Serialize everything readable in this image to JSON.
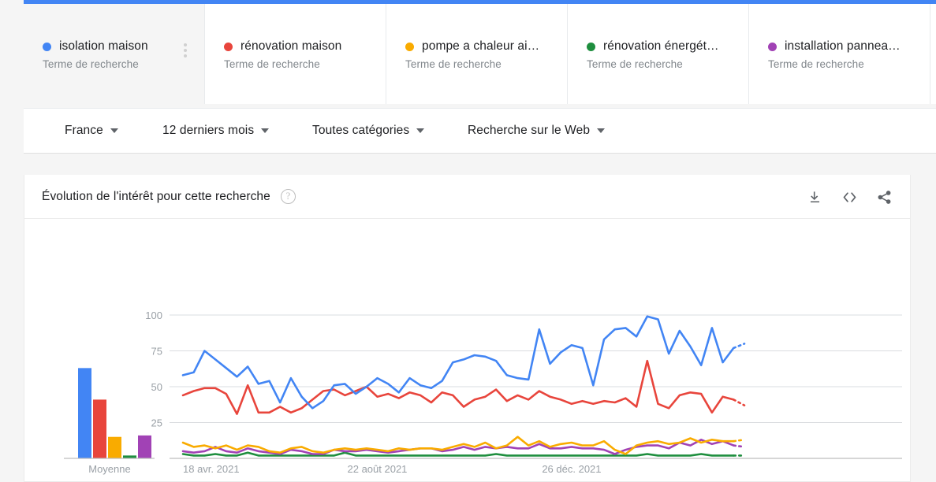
{
  "theme": {
    "blue": "#4285f4",
    "line_blue": "#3a86e0",
    "red": "#e8453c",
    "yellow": "#f9ab00",
    "green": "#1e8e3e",
    "purple": "#a142b5",
    "grid": "#dadce0",
    "axis_text": "#9aa0a6"
  },
  "terms": [
    {
      "label": "isolation maison",
      "sublabel": "Terme de recherche",
      "color": "#4285f4",
      "selected": true
    },
    {
      "label": "rénovation maison",
      "sublabel": "Terme de recherche",
      "color": "#e8453c",
      "selected": false
    },
    {
      "label": "pompe a chaleur ai…",
      "sublabel": "Terme de recherche",
      "color": "#f9ab00",
      "selected": false
    },
    {
      "label": "rénovation énergét…",
      "sublabel": "Terme de recherche",
      "color": "#1e8e3e",
      "selected": false
    },
    {
      "label": "installation pannea…",
      "sublabel": "Terme de recherche",
      "color": "#a142b5",
      "selected": false
    }
  ],
  "chip_menu": {
    "name": "more-options"
  },
  "filters": [
    {
      "label": "France"
    },
    {
      "label": "12 derniers mois"
    },
    {
      "label": "Toutes catégories"
    },
    {
      "label": "Recherche sur le Web"
    }
  ],
  "card": {
    "title": "Évolution de l'intérêt pour cette recherche",
    "help": "?",
    "actions": [
      {
        "name": "download-icon",
        "title": "Télécharger"
      },
      {
        "name": "embed-code-icon",
        "title": "Intégrer"
      },
      {
        "name": "share-icon",
        "title": "Partager"
      }
    ]
  },
  "average_panel": {
    "label": "Moyenne",
    "values": [
      63,
      41,
      15,
      2,
      16
    ]
  },
  "chart_data": {
    "type": "line",
    "title": "Évolution de l'intérêt pour cette recherche",
    "xlabel": "",
    "ylabel": "",
    "ylim": [
      0,
      100
    ],
    "yticks": [
      25,
      50,
      75,
      100
    ],
    "grid": true,
    "legend": "top-chips",
    "xticks": [
      "18 avr. 2021",
      "22 août 2021",
      "26 déc. 2021"
    ],
    "xtick_index": [
      0,
      18,
      36
    ],
    "n_points": 53,
    "partial_last_point": true,
    "series": [
      {
        "name": "isolation maison",
        "color": "#4285f4",
        "values": [
          58,
          60,
          75,
          69,
          63,
          57,
          64,
          52,
          54,
          39,
          56,
          43,
          35,
          40,
          51,
          52,
          45,
          50,
          56,
          52,
          46,
          56,
          51,
          49,
          54,
          67,
          69,
          72,
          71,
          68,
          58,
          56,
          55,
          90,
          66,
          74,
          79,
          77,
          51,
          83,
          90,
          91,
          85,
          99,
          97,
          73,
          89,
          78,
          65,
          91,
          67,
          77,
          80
        ]
      },
      {
        "name": "rénovation maison",
        "color": "#e8453c",
        "values": [
          44,
          47,
          49,
          49,
          45,
          31,
          51,
          32,
          32,
          36,
          32,
          35,
          41,
          47,
          48,
          44,
          47,
          50,
          43,
          45,
          42,
          46,
          44,
          39,
          46,
          44,
          36,
          41,
          43,
          48,
          40,
          44,
          41,
          47,
          43,
          41,
          38,
          40,
          38,
          40,
          39,
          42,
          36,
          68,
          38,
          35,
          44,
          46,
          45,
          32,
          43,
          41,
          37
        ]
      },
      {
        "name": "pompe a chaleur ai…",
        "color": "#f9ab00",
        "values": [
          11,
          8,
          9,
          7,
          9,
          6,
          9,
          8,
          5,
          4,
          7,
          8,
          5,
          4,
          6,
          7,
          6,
          7,
          6,
          5,
          7,
          6,
          7,
          7,
          6,
          8,
          10,
          8,
          11,
          7,
          9,
          15,
          9,
          12,
          8,
          10,
          11,
          9,
          9,
          12,
          6,
          3,
          9,
          11,
          12,
          10,
          11,
          14,
          11,
          13,
          12,
          12,
          13
        ]
      },
      {
        "name": "rénovation énergét…",
        "color": "#1e8e3e",
        "values": [
          3,
          2,
          2,
          3,
          2,
          2,
          4,
          2,
          2,
          2,
          2,
          2,
          2,
          2,
          2,
          4,
          2,
          2,
          2,
          2,
          2,
          2,
          2,
          2,
          2,
          2,
          2,
          2,
          2,
          3,
          2,
          2,
          2,
          2,
          2,
          2,
          2,
          2,
          2,
          2,
          2,
          2,
          2,
          3,
          2,
          2,
          2,
          2,
          3,
          2,
          2,
          2,
          2
        ]
      },
      {
        "name": "installation pannea…",
        "color": "#a142b5",
        "values": [
          5,
          4,
          5,
          8,
          5,
          4,
          7,
          5,
          4,
          3,
          6,
          5,
          3,
          3,
          6,
          5,
          5,
          6,
          5,
          4,
          5,
          6,
          7,
          7,
          5,
          6,
          8,
          6,
          8,
          7,
          8,
          7,
          7,
          10,
          7,
          7,
          8,
          7,
          7,
          6,
          3,
          6,
          8,
          9,
          9,
          7,
          11,
          9,
          13,
          10,
          12,
          9,
          8
        ]
      }
    ]
  }
}
